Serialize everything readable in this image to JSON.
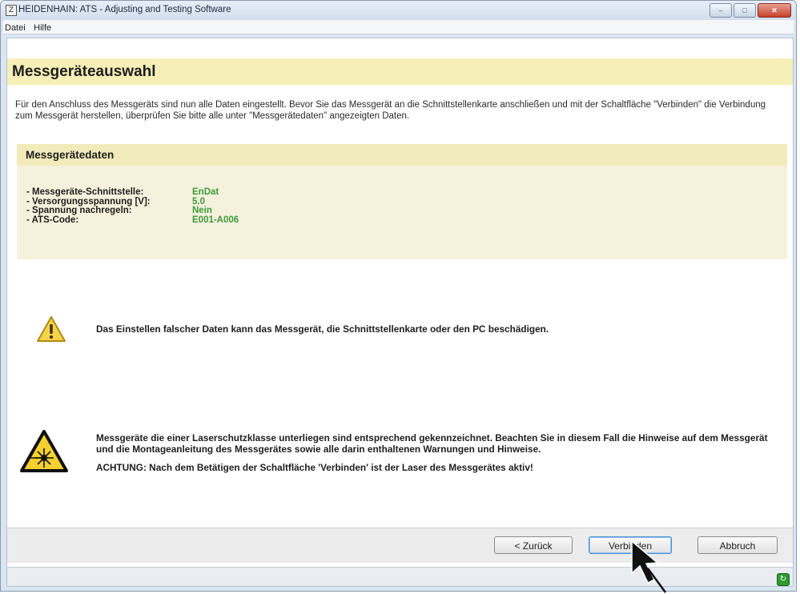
{
  "window": {
    "title": "HEIDENHAIN: ATS - Adjusting and Testing Software",
    "icon": "app-z-icon",
    "controls": {
      "minimize": "–",
      "maximize": "□",
      "close": "✕"
    }
  },
  "menu": [
    {
      "label": "Datei"
    },
    {
      "label": "Hilfe"
    }
  ],
  "page": {
    "title": "Messgeräteauswahl",
    "intro": "Für den Anschluss des Messgeräts sind nun alle Daten eingestellt. Bevor Sie das Messgerät an die Schnittstellenkarte anschließen und mit der Schaltfläche \"Verbinden\" die Verbindung zum Messgerät herstellen, überprüfen Sie bitte alle unter \"Messgerätedaten\" angezeigten Daten."
  },
  "device_data": {
    "title": "Messgerätedaten",
    "rows": [
      {
        "label": "- Messgeräte-Schnittstelle:",
        "value": "EnDat"
      },
      {
        "label": "- Versorgungsspannung [V]:",
        "value": "5.0"
      },
      {
        "label": "- Spannung nachregeln:",
        "value": "Nein"
      },
      {
        "label": "- ATS-Code:",
        "value": "E001-A006"
      }
    ],
    "value_color": "#3c9a3c"
  },
  "warning": {
    "icon": "warning-triangle-icon",
    "text": "Das Einstellen falscher Daten kann das Messgerät, die Schnittstellenkarte oder den PC beschädigen."
  },
  "laser": {
    "icon": "laser-hazard-icon",
    "text": "Messgeräte die einer Laserschutzklasse unterliegen sind entsprechend gekennzeichnet. Beachten Sie in diesem Fall die Hinweise auf dem Messgerät und die Montageanleitung des Messgerätes sowie alle darin enthaltenen Warnungen und Hinweise.",
    "note": "ACHTUNG: Nach dem Betätigen der Schaltfläche 'Verbinden' ist der Laser des Messgerätes aktiv!"
  },
  "buttons": {
    "back": "< Zurück",
    "connect": "Verbinden",
    "cancel": "Abbruch"
  },
  "status": {
    "icon": "connection-status-icon",
    "glyph": "↻"
  },
  "colors": {
    "header_band": "#f7efb8",
    "data_band": "#f1eaba",
    "data_panel": "#f6f1dc"
  }
}
